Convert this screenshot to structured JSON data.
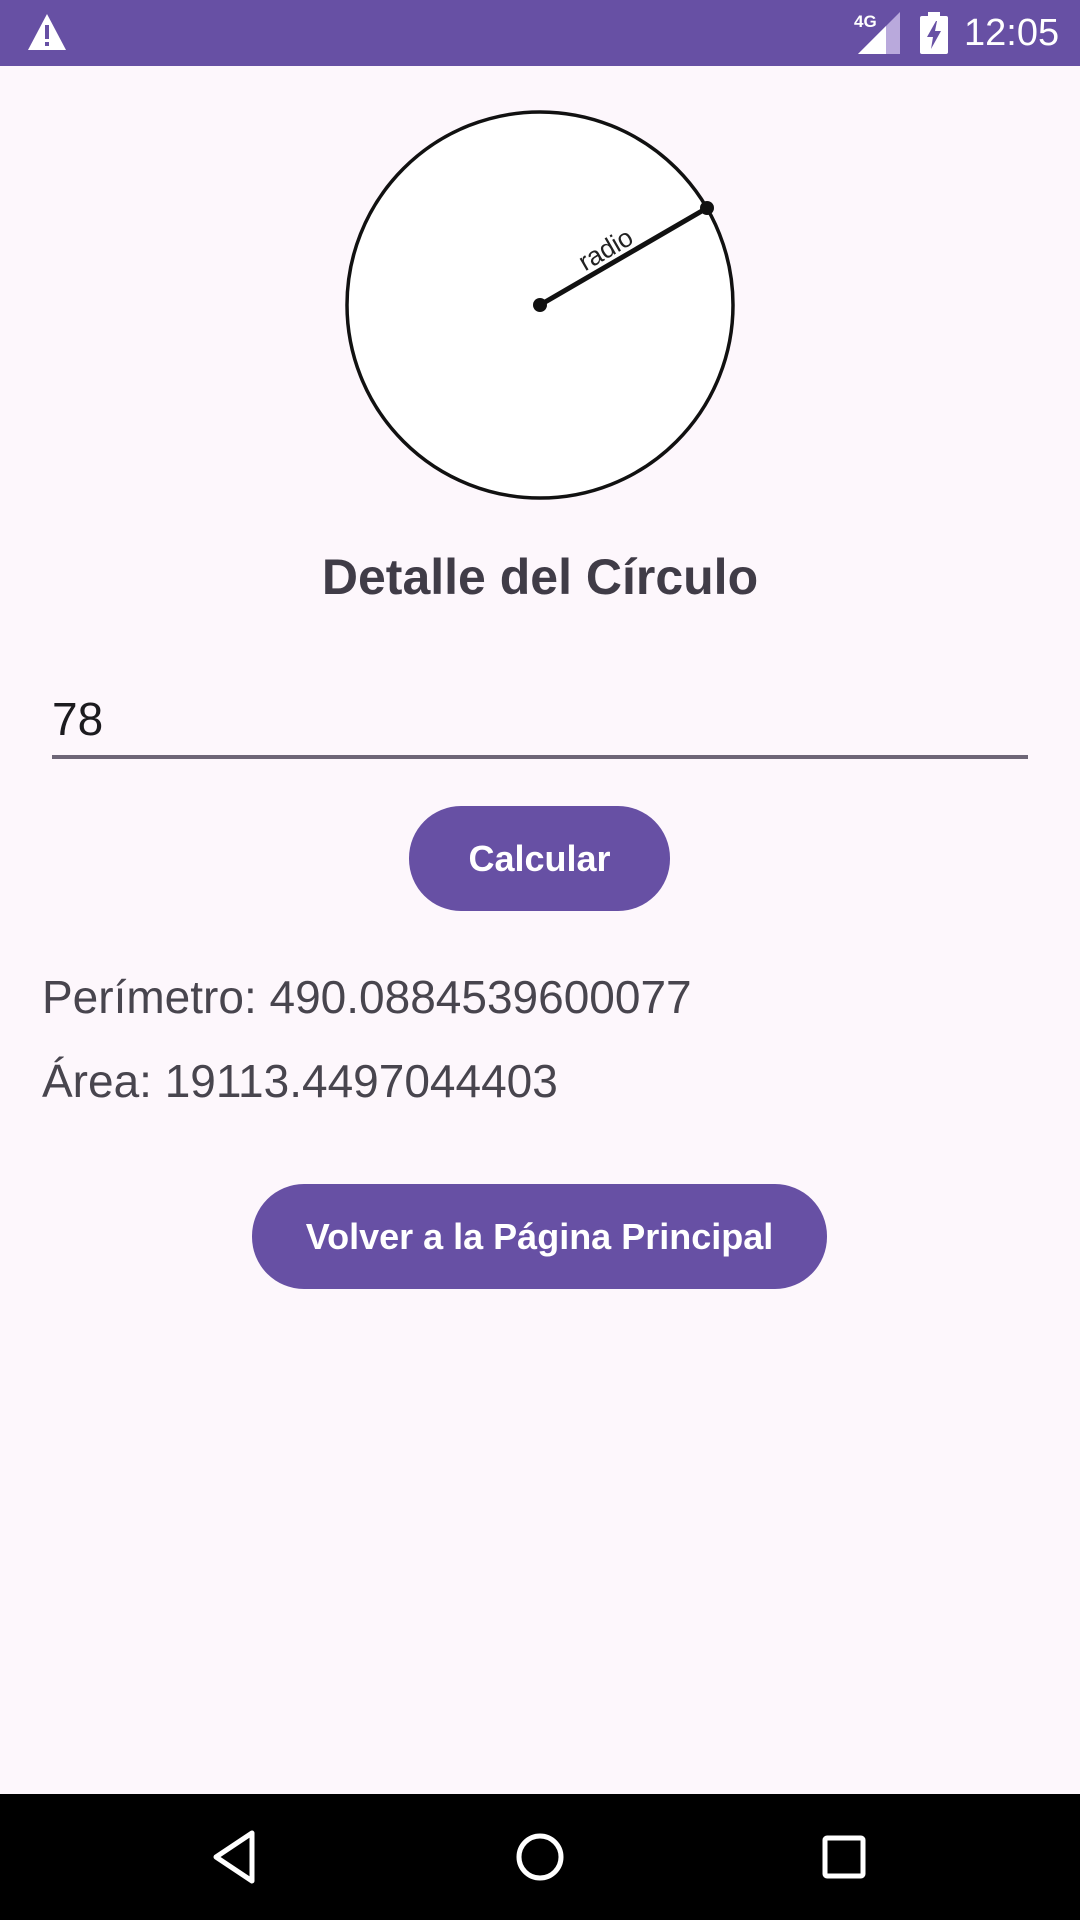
{
  "status_bar": {
    "network_label": "4G",
    "time": "12:05",
    "icons": [
      "warning-icon",
      "signal-icon",
      "battery-charging-icon"
    ]
  },
  "figure": {
    "radius_label": "radio"
  },
  "page": {
    "title": "Detalle del Círculo"
  },
  "radius_input": {
    "value": "78"
  },
  "buttons": {
    "calculate_label": "Calcular",
    "back_label": "Volver a la Página Principal"
  },
  "results": {
    "perimeter_text": "Perímetro: 490.0884539600077",
    "area_text": "Área: 19113.4497044403"
  },
  "navigation_bar": {
    "icons": [
      "back-icon",
      "home-icon",
      "recents-icon"
    ]
  },
  "colors": {
    "primary": "#6750a4",
    "background": "#fdf7fc",
    "title_text": "#403c47",
    "body_text": "#48454e"
  }
}
